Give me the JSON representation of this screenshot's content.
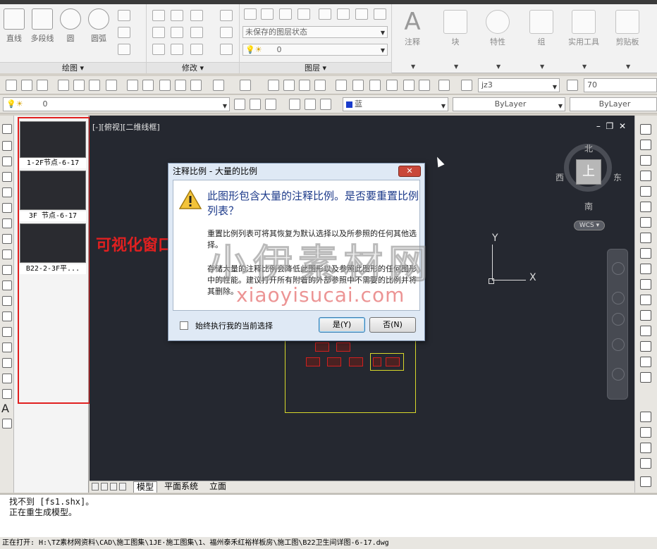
{
  "ribbon": {
    "draw_panel": {
      "title": "绘图",
      "tools": [
        "直线",
        "多段线",
        "圆",
        "圆弧"
      ]
    },
    "modify_panel": {
      "title": "修改"
    },
    "layers_panel": {
      "title": "图层",
      "layer_state": "未保存的图层状态",
      "current_layer": "0"
    },
    "right_tools": [
      "注释",
      "块",
      "特性",
      "组",
      "实用工具",
      "剪贴板"
    ]
  },
  "toolbar2": {
    "text_style": "jz3",
    "dim_value": "70"
  },
  "toolbar3": {
    "layer": "0",
    "color": "蓝",
    "linetype": "ByLayer",
    "lineweight": "ByLayer"
  },
  "sheets": [
    {
      "label": "1-2F节点-6-17"
    },
    {
      "label": "3F 节点-6-17"
    },
    {
      "label": "B22-2-3F平..."
    }
  ],
  "annotation": {
    "label": "可视化窗口",
    "color": "#e02020"
  },
  "viewport": {
    "label": "[-][俯视][二维线框]",
    "compass": {
      "north": "北",
      "south": "南",
      "east": "东",
      "west": "西",
      "top": "上"
    },
    "wcs": "WCS",
    "ucs_x": "X",
    "ucs_y": "Y"
  },
  "layout_tabs": [
    "模型",
    "平面系统",
    "立面"
  ],
  "dialog": {
    "title": "注释比例 - 大量的比例",
    "main": "此图形包含大量的注释比例。是否要重置比例列表？",
    "p1": "重置比例列表可将其恢复为默认选择以及所参照的任何其他选择。",
    "p2": "存储大量的注释比例会降低此图形以及参照此图形的任何图形中的性能。建议打开所有附着的外部参照中不需要的比例并将其删除。",
    "checkbox": "始终执行我的当前选择",
    "yes": "是(Y)",
    "no": "否(N)"
  },
  "watermark": {
    "text": "小伊素材网",
    "url": "xiaoyisucai.com"
  },
  "command": {
    "line1": "找不到 [fs1.shx]。",
    "line2": "正在重生成模型。"
  },
  "status": "正在打开: H:\\TZ素材网资料\\CAD\\施工图集\\1JE·施工图集\\1、福州泰禾红裕样板房\\施工图\\B22卫生间详图-6-17.dwg"
}
